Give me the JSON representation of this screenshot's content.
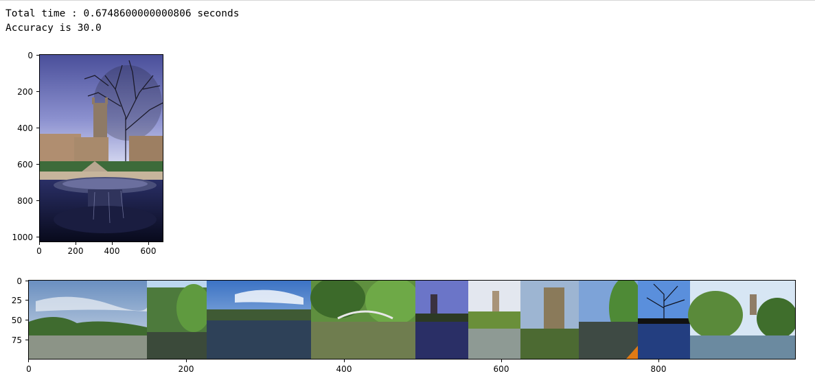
{
  "output": {
    "time_line": "Total time : 0.6748600000000806 seconds",
    "accuracy_line": "Accuracy is 30.0"
  },
  "plot1": {
    "yticks": [
      "0",
      "200",
      "400",
      "600",
      "800",
      "1000"
    ],
    "xticks": [
      "0",
      "200",
      "400",
      "600"
    ]
  },
  "plot2": {
    "yticks": [
      "0",
      "25",
      "50",
      "75"
    ],
    "xticks": [
      "0",
      "200",
      "400",
      "600",
      "800"
    ]
  }
}
